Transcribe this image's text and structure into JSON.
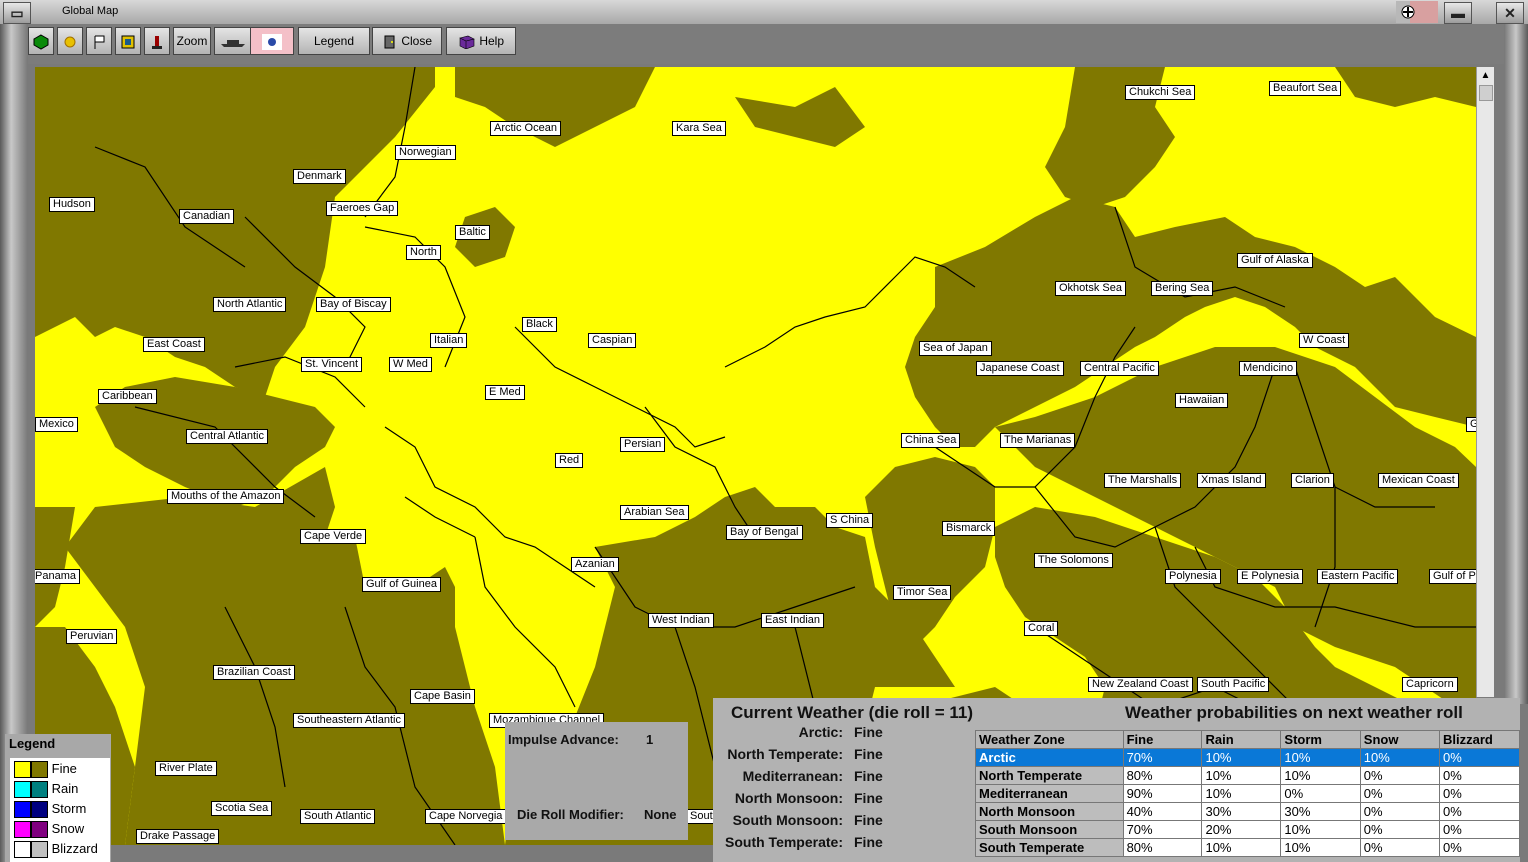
{
  "window": {
    "title": "Global Map"
  },
  "toolbar": {
    "zoom_label": "Zoom",
    "legend_label": "Legend",
    "close_label": "Close",
    "help_label": "Help"
  },
  "map": {
    "labels": [
      "Arctic Ocean",
      "Kara Sea",
      "Chukchi Sea",
      "Beaufort Sea",
      "Norwegian",
      "Denmark",
      "Hudson",
      "Canadian",
      "Faeroes Gap",
      "Baltic",
      "North",
      "Gulf of Alaska",
      "Okhotsk Sea",
      "Bering Sea",
      "North Atlantic",
      "Bay of Biscay",
      "Black",
      "Caspian",
      "East Coast",
      "Italian",
      "Sea of Japan",
      "W Coast",
      "St. Vincent",
      "W Med",
      "Japanese Coast",
      "Central Pacific",
      "Mendicino",
      "E Med",
      "Caribbean",
      "Mexico",
      "Hawaiian",
      "Central Atlantic",
      "China Sea",
      "The Marianas",
      "Persian",
      "Red",
      "Mouths of the Amazon",
      "The Marshalls",
      "Xmas Island",
      "Clarion",
      "Mexican Coast",
      "Arabian Sea",
      "S China",
      "Bismarck",
      "Cape Verde",
      "Bay of Bengal",
      "The Solomons",
      "Azanian",
      "Panama",
      "Polynesia",
      "E Polynesia",
      "Eastern Pacific",
      "Gulf of P",
      "Gulf of Guinea",
      "Timor Sea",
      "West Indian",
      "East Indian",
      "Coral",
      "Peruvian",
      "Brazilian Coast",
      "New Zealand Coast",
      "South Pacific",
      "Capricorn",
      "Cape Basin",
      "Southeastern Atlantic",
      "Mozambique Channel",
      "River Plate",
      "Scotia Sea",
      "South Atlantic",
      "Cape Norvegia",
      "South",
      "Drake Passage",
      "G"
    ]
  },
  "legend": {
    "title": "Legend",
    "items": [
      {
        "label": "Fine",
        "c1": "#ffff00",
        "c2": "#807800"
      },
      {
        "label": "Rain",
        "c1": "#00ffff",
        "c2": "#008080"
      },
      {
        "label": "Storm",
        "c1": "#0000ff",
        "c2": "#000080"
      },
      {
        "label": "Snow",
        "c1": "#ff00ff",
        "c2": "#800080"
      },
      {
        "label": "Blizzard",
        "c1": "#ffffff",
        "c2": "#c0c0c0"
      }
    ]
  },
  "impulse": {
    "advance_label": "Impulse Advance:",
    "advance_value": "1",
    "modifier_label": "Die Roll Modifier:",
    "modifier_value": "None"
  },
  "weather": {
    "current_title": "Current Weather (die roll = 11)",
    "next_title": "Weather probabilities on next weather roll",
    "current": [
      {
        "zone": "Arctic:",
        "value": "Fine"
      },
      {
        "zone": "North Temperate:",
        "value": "Fine"
      },
      {
        "zone": "Mediterranean:",
        "value": "Fine"
      },
      {
        "zone": "North Monsoon:",
        "value": "Fine"
      },
      {
        "zone": "South Monsoon:",
        "value": "Fine"
      },
      {
        "zone": "South Temperate:",
        "value": "Fine"
      }
    ],
    "table_headers": [
      "Weather Zone",
      "Fine",
      "Rain",
      "Storm",
      "Snow",
      "Blizzard"
    ],
    "rows": [
      {
        "zone": "Arctic",
        "vals": [
          "70%",
          "10%",
          "10%",
          "10%",
          "0%"
        ]
      },
      {
        "zone": "North Temperate",
        "vals": [
          "80%",
          "10%",
          "10%",
          "0%",
          "0%"
        ]
      },
      {
        "zone": "Mediterranean",
        "vals": [
          "90%",
          "10%",
          "0%",
          "0%",
          "0%"
        ]
      },
      {
        "zone": "North Monsoon",
        "vals": [
          "40%",
          "30%",
          "30%",
          "0%",
          "0%"
        ]
      },
      {
        "zone": "South Monsoon",
        "vals": [
          "70%",
          "20%",
          "10%",
          "0%",
          "0%"
        ]
      },
      {
        "zone": "South Temperate",
        "vals": [
          "80%",
          "10%",
          "10%",
          "0%",
          "0%"
        ]
      }
    ]
  },
  "colors": {
    "fine_light": "#ffff00",
    "fine_dark": "#807800",
    "selected": "#0a78d7"
  }
}
